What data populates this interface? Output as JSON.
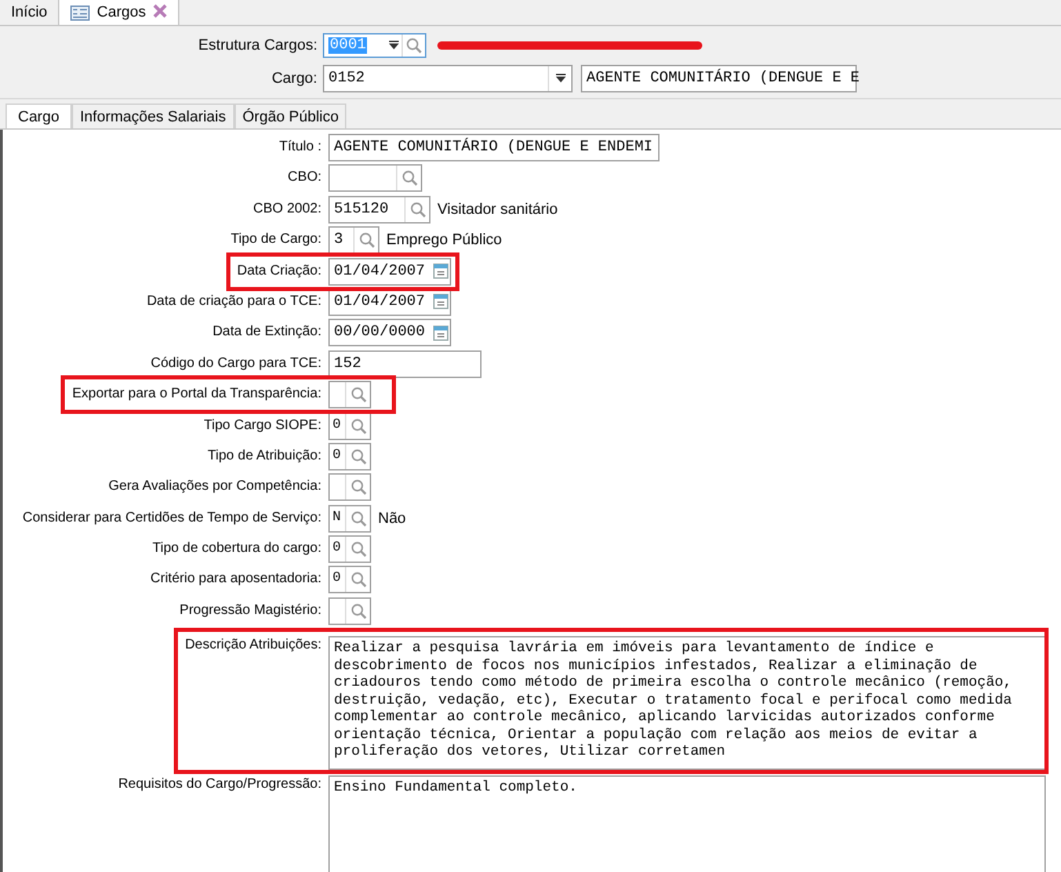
{
  "doc_tabs": [
    {
      "label": "Início",
      "selected": false,
      "closable": false
    },
    {
      "label": "Cargos",
      "selected": true,
      "closable": true
    }
  ],
  "header": {
    "estrutura": {
      "label": "Estrutura Cargos:",
      "value": "0001",
      "marked": true
    },
    "cargo": {
      "label": "Cargo:",
      "value": "0152",
      "description": "AGENTE COMUNITÁRIO (DENGUE E E"
    }
  },
  "form_tabs": [
    {
      "label": "Cargo",
      "selected": true
    },
    {
      "label": "Informações Salariais",
      "selected": false
    },
    {
      "label": "Órgão Público",
      "selected": false
    }
  ],
  "fields": [
    {
      "label": "Título :",
      "kind": "text",
      "value": "AGENTE COMUNITÁRIO (DENGUE E ENDEMI",
      "highlighted": false
    },
    {
      "label": "CBO:",
      "kind": "lookup",
      "highlighted": false
    },
    {
      "label": "CBO 2002:",
      "kind": "lookup",
      "value": "515120",
      "note": "Visitador sanitário",
      "highlighted": false
    },
    {
      "label": "Tipo de Cargo:",
      "kind": "lookup",
      "value": "3",
      "note": "Emprego Público",
      "highlighted": false
    },
    {
      "label": "Data Criação:",
      "kind": "date",
      "value": "01/04/2007",
      "highlighted": true
    },
    {
      "label": "Data de criação para o TCE:",
      "kind": "date",
      "value": "01/04/2007",
      "highlighted": false
    },
    {
      "label": "Data de Extinção:",
      "kind": "date",
      "value": "00/00/0000",
      "highlighted": false
    },
    {
      "label": "Código do Cargo para TCE:",
      "kind": "text",
      "value": "152",
      "highlighted": false
    },
    {
      "label": "Exportar para o Portal da Transparência:",
      "kind": "lookup",
      "highlighted": true
    },
    {
      "label": "Tipo Cargo SIOPE:",
      "kind": "lookup",
      "value": "0",
      "highlighted": false
    },
    {
      "label": "Tipo de Atribuição:",
      "kind": "lookup",
      "value": "0",
      "highlighted": false
    },
    {
      "label": "Gera Avaliações por Competência:",
      "kind": "lookup",
      "highlighted": false
    },
    {
      "label": "Considerar para Certidões de Tempo de Serviço:",
      "kind": "lookup",
      "value": "N",
      "note": "Não",
      "highlighted": false
    },
    {
      "label": "Tipo de cobertura do cargo:",
      "kind": "lookup",
      "value": "0",
      "highlighted": false
    },
    {
      "label": "Critério para aposentadoria:",
      "kind": "lookup",
      "value": "0",
      "highlighted": false
    },
    {
      "label": "Progressão Magistério:",
      "kind": "lookup",
      "highlighted": false
    },
    {
      "label": "Descrição Atribuições:",
      "kind": "memo",
      "value": "Realizar a pesquisa lavrária em imóveis para levantamento de índice e descobrimento de focos nos municípios infestados, Realizar a eliminação de criadouros tendo como método de primeira escolha o controle mecânico (remoção, destruição, vedação, etc), Executar o tratamento focal e perifocal como medida complementar ao controle mecânico, aplicando larvicidas autorizados conforme orientação técnica, Orientar a população com relação aos meios de evitar a proliferação dos vetores, Utilizar corretamen",
      "highlighted": true
    },
    {
      "label": "Requisitos do Cargo/Progressão:",
      "kind": "memo",
      "value": "Ensino Fundamental completo.",
      "highlighted": false
    }
  ]
}
